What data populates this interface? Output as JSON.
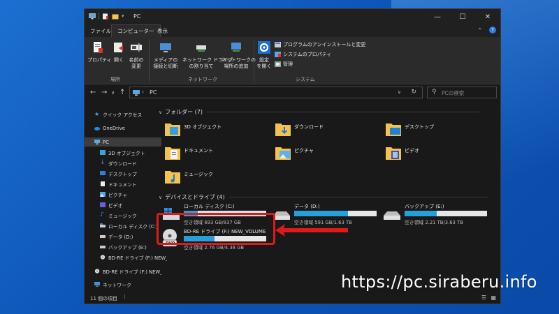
{
  "window": {
    "title": "PC"
  },
  "ribbon": {
    "tabs": [
      "ファイル",
      "コンピューター",
      "表示"
    ],
    "buttons": [
      {
        "label": "プロパティ"
      },
      {
        "label": "開く"
      },
      {
        "label": "名前の\n変更"
      },
      {
        "label": "メディアの\n接続と切断"
      },
      {
        "label": "ネットワーク ドライブ\nの割り当て"
      },
      {
        "label": "ネットワークの\n場所の追加"
      },
      {
        "label": "設定\nを開く"
      }
    ],
    "system_items": [
      "プログラムのアンインストールと変更",
      "システムのプロパティ",
      "管理"
    ],
    "groups": [
      "場所",
      "ネットワーク",
      "システム"
    ]
  },
  "address": {
    "path": "PC",
    "search_placeholder": "PCの検索"
  },
  "nav": [
    {
      "label": "クイック アクセス",
      "icon": "star-icon"
    },
    {
      "label": "OneDrive",
      "icon": "cloud-icon"
    },
    {
      "label": "PC",
      "icon": "computer-icon"
    },
    {
      "label": "3D オブジェクト",
      "icon": "cube-icon"
    },
    {
      "label": "ダウンロード",
      "icon": "download-icon"
    },
    {
      "label": "デスクトップ",
      "icon": "desktop-icon"
    },
    {
      "label": "ドキュメント",
      "icon": "document-icon"
    },
    {
      "label": "ピクチャ",
      "icon": "picture-icon"
    },
    {
      "label": "ビデオ",
      "icon": "video-icon"
    },
    {
      "label": "ミュージック",
      "icon": "music-icon"
    },
    {
      "label": "ローカル ディスク (C:)",
      "icon": "disk-icon"
    },
    {
      "label": "データ (D:)",
      "icon": "disk-icon"
    },
    {
      "label": "バックアップ (E:)",
      "icon": "disk-icon"
    },
    {
      "label": "BD-RE ドライブ (F:) NEW_VOLUME",
      "icon": "disc-icon"
    },
    {
      "label": "BD-RE ドライブ (F:) NEW_VOLUME",
      "icon": "disc-icon"
    },
    {
      "label": "ネットワーク",
      "icon": "network-icon"
    }
  ],
  "sections": {
    "folders": "フォルダー (7)",
    "drives": "デバイスとドライブ (4)"
  },
  "folders": [
    "3D オブジェクト",
    "ダウンロード",
    "デスクトップ",
    "ドキュメント",
    "ピクチャ",
    "ビデオ",
    "ミュージック"
  ],
  "drives": [
    {
      "name": "ローカル ディスク (C:)",
      "free": "空き領域 693 GB/837 GB",
      "used_fraction": 0.17
    },
    {
      "name": "データ (D:)",
      "free": "空き領域 591 GB/1.63 TB",
      "used_fraction": 0.65
    },
    {
      "name": "バックアップ (E:)",
      "free": "空き領域 2.21 TB/3.63 TB",
      "used_fraction": 0.39
    },
    {
      "name": "BD-RE ドライブ (F:) NEW_VOLUME",
      "free": "空き領域 2.76 GB/4.38 GB",
      "used_fraction": 0.37,
      "badge": "DVD"
    }
  ],
  "status": {
    "count": "11 個の項目"
  },
  "watermark": "https://pc.siraberu.info",
  "colors": {
    "accent": "#26a0da",
    "highlight": "#e0191b",
    "folder": "#f3c34d"
  }
}
